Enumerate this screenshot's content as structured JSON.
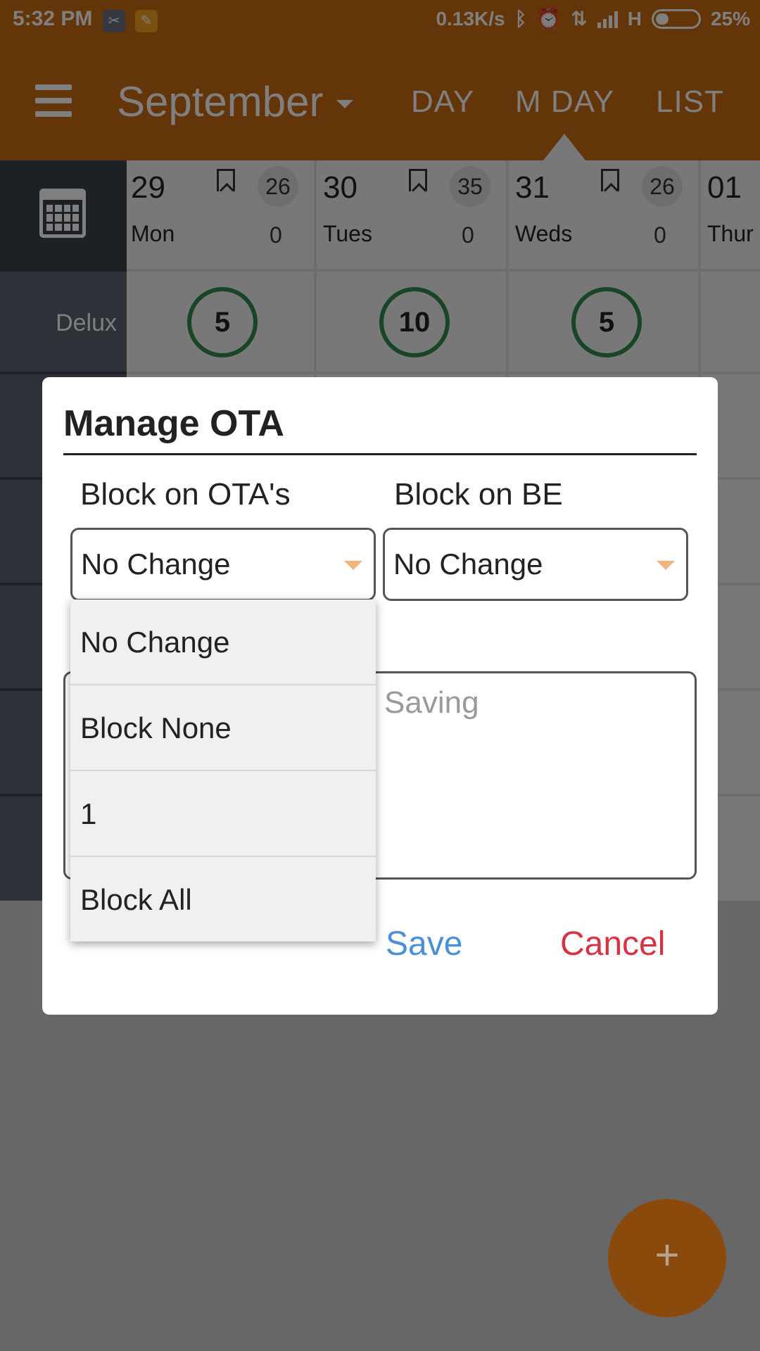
{
  "status_bar": {
    "time": "5:32 PM",
    "speed": "0.13K/s",
    "network": "H",
    "battery": "25%"
  },
  "app_bar": {
    "month": "September",
    "tabs": [
      {
        "label": "DAY"
      },
      {
        "label": "M DAY"
      },
      {
        "label": "LIST"
      }
    ],
    "selected_tab": "M DAY"
  },
  "calendar": {
    "room_label": "Delux",
    "days": [
      {
        "num": "29",
        "dow": "Mon",
        "avail": "26",
        "zero": "0",
        "count": "5"
      },
      {
        "num": "30",
        "dow": "Tues",
        "avail": "35",
        "zero": "0",
        "count": "10"
      },
      {
        "num": "31",
        "dow": "Weds",
        "avail": "26",
        "zero": "0",
        "count": "5"
      },
      {
        "num": "01",
        "dow": "Thur"
      }
    ]
  },
  "dialog": {
    "title": "Manage OTA",
    "ota_label": "Block on OTA's",
    "be_label": "Block on BE",
    "ota_value": "No Change",
    "be_value": "No Change",
    "notes_placeholder": "Saving",
    "save_label": "Save",
    "cancel_label": "Cancel"
  },
  "dropdown": {
    "options": [
      "No Change",
      "Block None",
      "1",
      "Block All"
    ]
  },
  "fab": {
    "label": "+"
  },
  "colors": {
    "brand": "#c76a12",
    "save": "#4a90d9",
    "cancel": "#d63345",
    "ring": "#2e8b4a"
  }
}
